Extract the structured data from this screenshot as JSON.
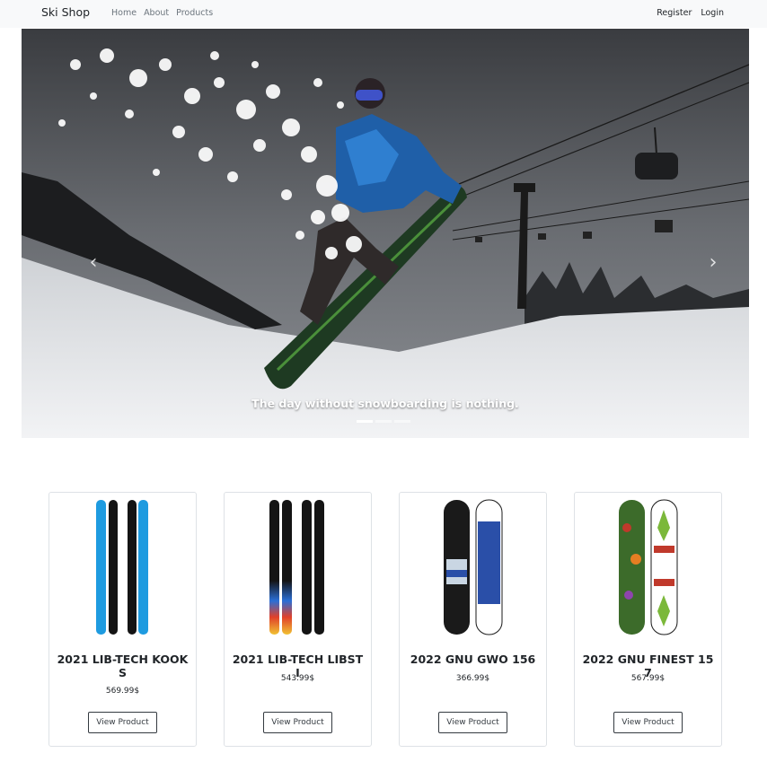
{
  "navbar": {
    "brand": "Ski Shop",
    "links": [
      "Home",
      "About",
      "Products"
    ],
    "right_links": [
      "Register",
      "Login"
    ]
  },
  "carousel": {
    "caption": "The day without snowboarding is nothing.",
    "slide_count": 3,
    "active_slide": 1
  },
  "products": [
    {
      "title": "2021 LIB-TECH KOOKS",
      "price": "569.99$",
      "button": "View Product"
    },
    {
      "title": "2021 LIB-TECH LIBSTI",
      "price": "543.99$",
      "button": "View Product"
    },
    {
      "title": "2022 GNU GWO 156",
      "price": "366.99$",
      "button": "View Product"
    },
    {
      "title": "2022 GNU FINEST 157",
      "price": "567.99$",
      "button": "View Product"
    }
  ],
  "colors": {
    "navbar_bg": "#f8f9fa",
    "ski_blue": "#1e9be0",
    "gnu_blue": "#2a4fa8",
    "finest_green": "#3c6b2a"
  }
}
